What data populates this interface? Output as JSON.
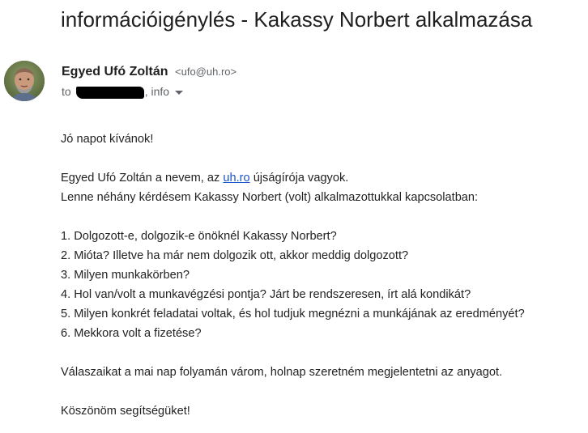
{
  "email": {
    "subject": "információigénylés - Kakassy Norbert alkalmazása",
    "sender": {
      "name": "Egyed Ufó Zoltán",
      "email": "<ufo@uh.ro>"
    },
    "recipients": {
      "prefix": "to",
      "suffix": ", info"
    },
    "body": {
      "greeting": "Jó napot kívánok!",
      "intro_before_link": "Egyed Ufó Zoltán a nevem, az ",
      "link_text": "uh.ro",
      "intro_after_link": " újságírója vagyok.",
      "request": "Lenne néhány kérdésem Kakassy Norbert (volt) alkalmazottukkal kapcsolatban:",
      "questions": [
        "1. Dolgozott-e, dolgozik-e önöknél Kakassy Norbert?",
        "2. Mióta? Illetve ha már nem dolgozik ott, akkor meddig dolgozott?",
        "3. Milyen munkakörben?",
        "4. Hol van/volt a munkavégzési pontja? Járt be rendszeresen, írt alá kondikát?",
        "5. Milyen konkrét feladatai voltak, és hol tudjuk megnézni a munkájának az eredményét?",
        "6. Mekkora volt a fizetése?"
      ],
      "closing_request": "Válaszaikat a mai nap folyamán várom, holnap szeretném megjelentetni az anyagot.",
      "thanks": "Köszönöm segítségüket!"
    }
  },
  "icons": {
    "avatar": "sender-avatar",
    "details_caret": "chevron-down-icon"
  },
  "colors": {
    "link": "#1a55c7",
    "muted": "#5f6368"
  }
}
